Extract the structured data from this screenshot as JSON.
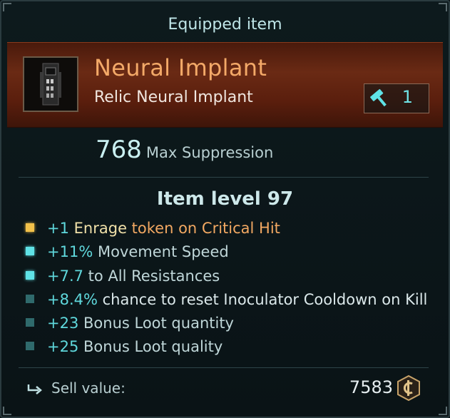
{
  "panel": {
    "title": "Equipped item"
  },
  "item": {
    "name": "Neural Implant",
    "subtitle": "Relic Neural Implant",
    "upgrade_count": "1",
    "stat_value": "768",
    "stat_label": "Max Suppression",
    "level_text": "Item level 97"
  },
  "affixes": [
    {
      "bullet": "gold",
      "prefix": "+1",
      "text_a": "Enrage",
      "text_b": " token on Critical Hit"
    },
    {
      "bullet": "cyan",
      "prefix": "+11%",
      "text": " Movement Speed"
    },
    {
      "bullet": "cyan",
      "prefix": "+7.7",
      "text": " to All Resistances"
    },
    {
      "bullet": "dim",
      "prefix": "+8.4%",
      "text": " chance to reset Inoculator Cooldown on Kill"
    },
    {
      "bullet": "dim",
      "prefix": "+23",
      "text": " Bonus Loot quantity"
    },
    {
      "bullet": "dim",
      "prefix": "+25",
      "text": " Bonus Loot quality"
    }
  ],
  "sell": {
    "label": "Sell value:",
    "value": "7583"
  },
  "colors": {
    "rarity": "#f3a968",
    "accent": "#5fd8dc",
    "header_bg": "#5a1e0d"
  },
  "icons": {
    "upgrade": "hammer-icon",
    "sell": "return-arrow-icon",
    "currency": "hex-coin-icon"
  }
}
